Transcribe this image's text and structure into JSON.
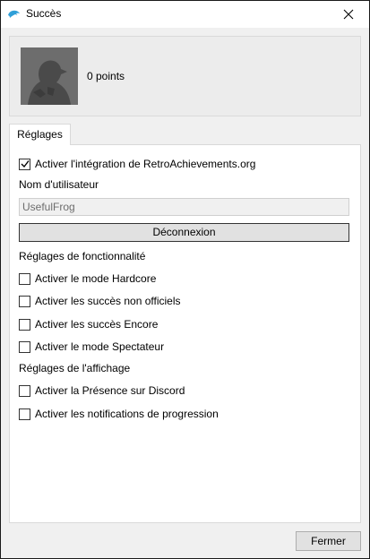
{
  "window": {
    "title": "Succès",
    "icon": "dolphin-icon"
  },
  "profile": {
    "points_label": "0 points",
    "avatar": "avatar-silhouette"
  },
  "tabs": [
    {
      "label": "Réglages"
    }
  ],
  "settings": {
    "enable_integration": {
      "label": "Activer l'intégration de RetroAchievements.org",
      "checked": true
    },
    "username_label": "Nom d'utilisateur",
    "username_value": "UsefulFrog",
    "logout_label": "Déconnexion",
    "functionality_heading": "Réglages de fonctionnalité",
    "functionality_options": [
      {
        "label": "Activer le mode Hardcore",
        "checked": false
      },
      {
        "label": "Activer les succès non officiels",
        "checked": false
      },
      {
        "label": "Activer les succès Encore",
        "checked": false
      },
      {
        "label": "Activer le mode Spectateur",
        "checked": false
      }
    ],
    "display_heading": "Réglages de l'affichage",
    "display_options": [
      {
        "label": "Activer la Présence sur Discord",
        "checked": false
      },
      {
        "label": "Activer les notifications de progression",
        "checked": false
      }
    ]
  },
  "footer": {
    "close_label": "Fermer"
  }
}
